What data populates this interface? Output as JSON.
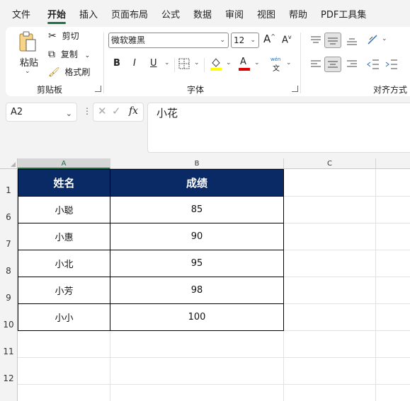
{
  "menu": {
    "items": [
      "文件",
      "开始",
      "插入",
      "页面布局",
      "公式",
      "数据",
      "审阅",
      "视图",
      "帮助",
      "PDF工具集"
    ],
    "active": "开始"
  },
  "ribbon": {
    "clipboard": {
      "paste_label": "粘贴",
      "cut_label": "剪切",
      "copy_label": "复制",
      "format_painter_label": "格式刷",
      "group_label": "剪贴板"
    },
    "font": {
      "font_name": "微软雅黑",
      "font_size": "12",
      "grow_label": "A",
      "shrink_label": "A",
      "bold": "B",
      "italic": "I",
      "underline": "U",
      "font_color_letter": "A",
      "phonetic_top": "wén",
      "phonetic_bottom": "文",
      "group_label": "字体"
    },
    "alignment": {
      "group_label": "对齐方式"
    },
    "colors": {
      "highlight": "#ffff00",
      "font_color": "#e00000"
    }
  },
  "formula_bar": {
    "name_box": "A2",
    "fx_label": "fx",
    "content": "小花"
  },
  "grid": {
    "columns": [
      "A",
      "B",
      "C"
    ],
    "selected_column": "A",
    "row_numbers": [
      "1",
      "6",
      "7",
      "8",
      "9",
      "10",
      "11",
      "12"
    ],
    "table": {
      "headers": [
        "姓名",
        "成绩"
      ],
      "rows": [
        [
          "小聪",
          "85"
        ],
        [
          "小惠",
          "90"
        ],
        [
          "小北",
          "95"
        ],
        [
          "小芳",
          "98"
        ],
        [
          "小小",
          "100"
        ]
      ]
    },
    "header_fill": "#0a2a66"
  }
}
